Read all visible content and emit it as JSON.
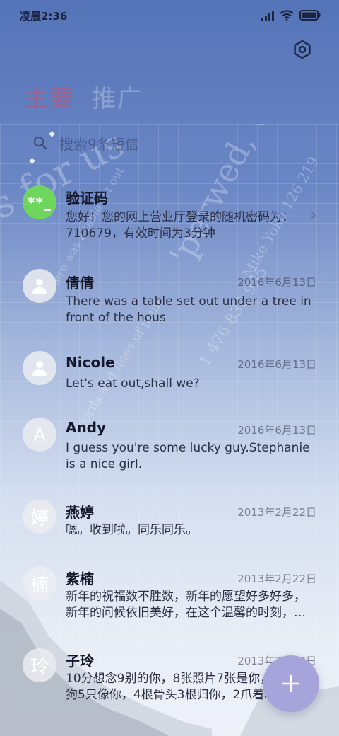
{
  "status_bar": {
    "time": "凌晨2:36"
  },
  "header": {
    "settings_icon": "settings-gear-icon",
    "tabs": [
      {
        "label": "主要",
        "active": true
      },
      {
        "label": "推广",
        "active": false
      }
    ]
  },
  "search": {
    "placeholder": "搜索9条短信"
  },
  "messages": [
    {
      "name": "验证码",
      "date": "",
      "preview": "您好！您的网上营业厅登录的随机密码为：710679，有效时间为3分钟",
      "avatar": "**_"
    },
    {
      "name": "倩倩",
      "date": "2016年6月13日",
      "preview": "There was a table set out under a tree in front of the hous",
      "avatar": ""
    },
    {
      "name": "Nicole",
      "date": "2016年6月13日",
      "preview": "Let's eat out,shall we?",
      "avatar": ""
    },
    {
      "name": "Andy",
      "date": "2016年6月13日",
      "preview": "I guess you're some lucky guy.Stephanie is a nice girl.",
      "avatar": "A"
    },
    {
      "name": "燕婷",
      "date": "2013年2月22日",
      "preview": "嗯。收到啦。同乐同乐。",
      "avatar": "婷"
    },
    {
      "name": "紫楠",
      "date": "2013年2月22日",
      "preview": "新年的祝福数不胜数，新年的愿望好多好多，新年的问候依旧美好，在这个温馨的时刻，…",
      "avatar": "楠"
    },
    {
      "name": "子玲",
      "date": "2013年2月22日",
      "preview": "10分想念9别的你，8张照片7张是你，6条小狗5只像你，4根骨头3根归你，2爪着地1…",
      "avatar": "玲"
    }
  ],
  "fab": {
    "icon": "plus-icon"
  },
  "colors": {
    "header_blue": "#5574b8",
    "fab": "#a7a4dc",
    "verification_avatar": "#6fd65d"
  }
}
